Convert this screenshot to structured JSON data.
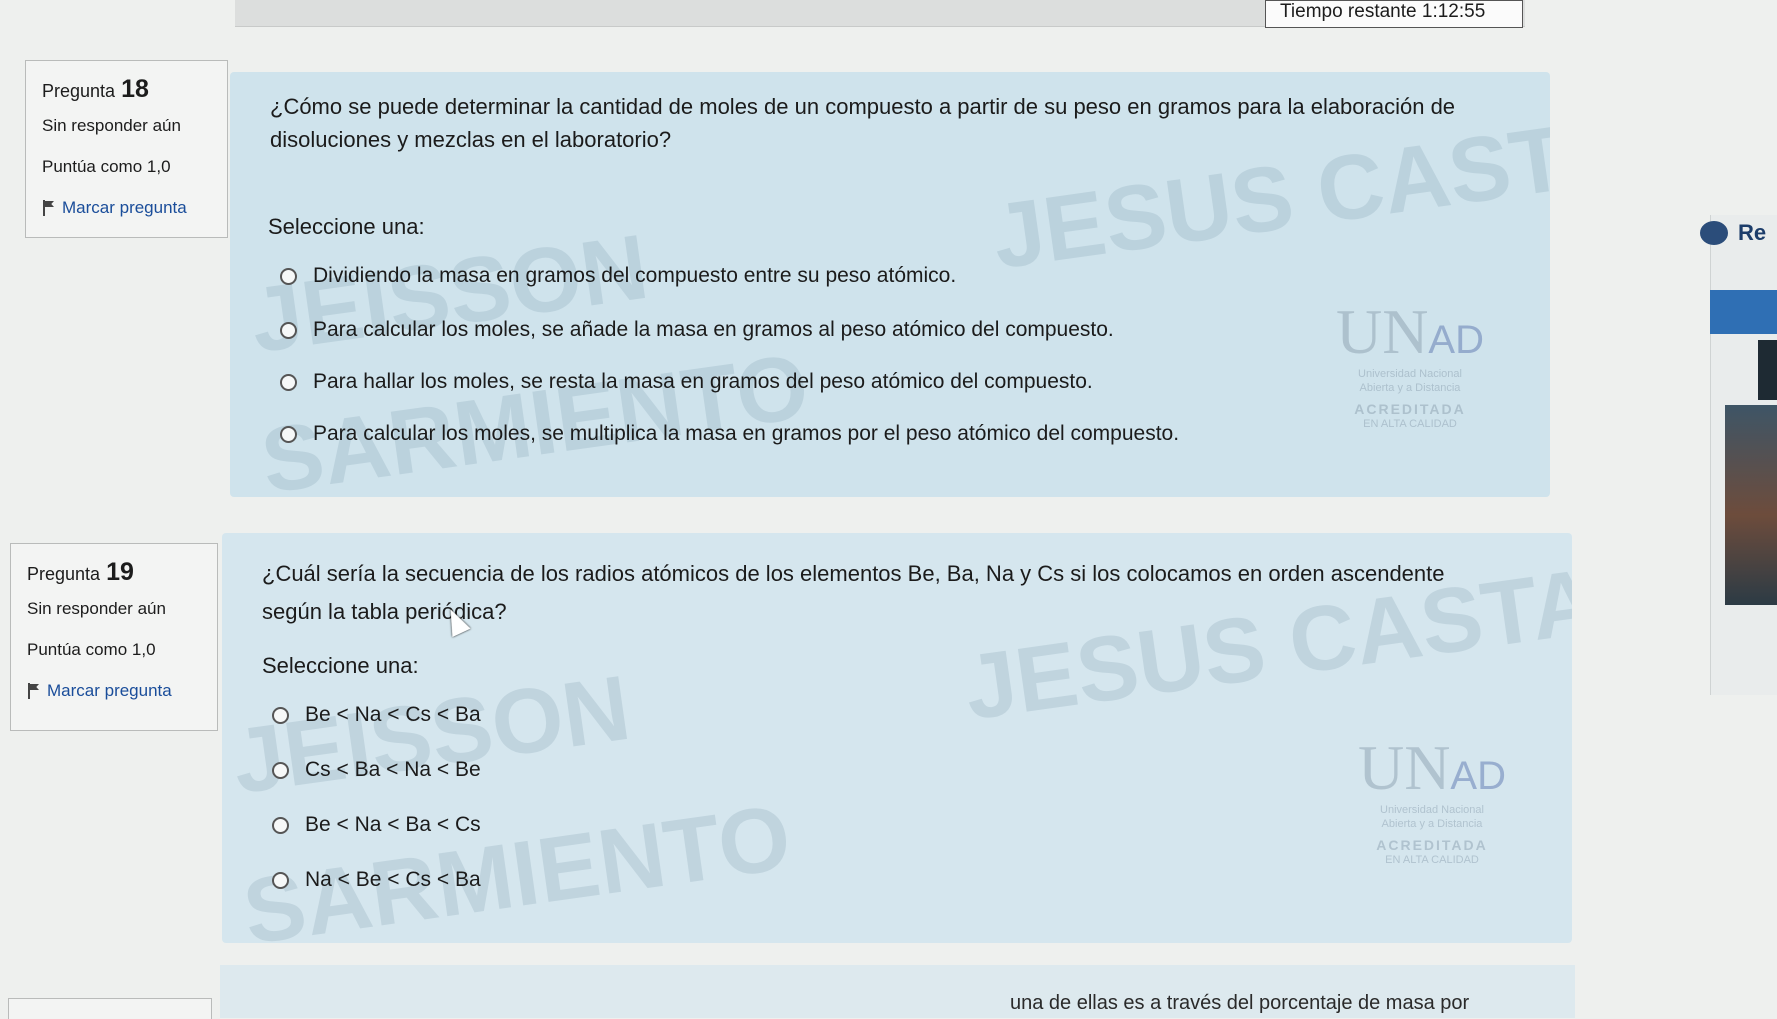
{
  "header": {
    "timer_label": "Tiempo restante",
    "timer_value": "1:12:55"
  },
  "questions": [
    {
      "number_label": "Pregunta",
      "number": "18",
      "status": "Sin responder aún",
      "points": "Puntúa como 1,0",
      "flag_label": "Marcar pregunta",
      "text_line1": "¿Cómo se puede determinar la cantidad de moles de un compuesto a partir de su peso en gramos para la elaboración de",
      "text_line2": "disoluciones y mezclas en el laboratorio?",
      "prompt": "Seleccione una:",
      "options": [
        "Dividiendo la masa en gramos del compuesto entre su peso atómico.",
        "Para calcular los moles, se añade la masa en gramos al peso atómico del compuesto.",
        "Para hallar los moles, se resta la masa en gramos del peso atómico del compuesto.",
        "Para calcular los moles, se multiplica la masa en gramos por el peso atómico del compuesto."
      ]
    },
    {
      "number_label": "Pregunta",
      "number": "19",
      "status": "Sin responder aún",
      "points": "Puntúa como 1,0",
      "flag_label": "Marcar pregunta",
      "text_line1": "¿Cuál sería la secuencia de los radios atómicos de los elementos Be, Ba, Na y Cs si los colocamos en orden ascendente",
      "text_line2": "según la tabla periódica?",
      "prompt": "Seleccione una:",
      "options": [
        "Be < Na < Cs < Ba",
        "Cs < Ba < Na < Be",
        "Be < Na < Ba < Cs",
        "Na < Be < Cs < Ba"
      ]
    }
  ],
  "watermark": {
    "line1": "JESUS CASTAÑO",
    "line2": "JEISSON",
    "line3": "SARMIENTO"
  },
  "logo": {
    "u": "U",
    "n": "N",
    "ad": "AD",
    "line1": "Universidad Nacional",
    "line2": "Abierta y a Distancia",
    "acc": "ACREDITADA",
    "quality": "EN ALTA CALIDAD"
  },
  "side": {
    "review_label": "Re"
  },
  "footer": {
    "partial_text": "una de ellas es a través del porcentaje de masa por"
  },
  "icons": {
    "flag": "flag-icon",
    "radio": "radio-button",
    "review": "review-icon"
  }
}
